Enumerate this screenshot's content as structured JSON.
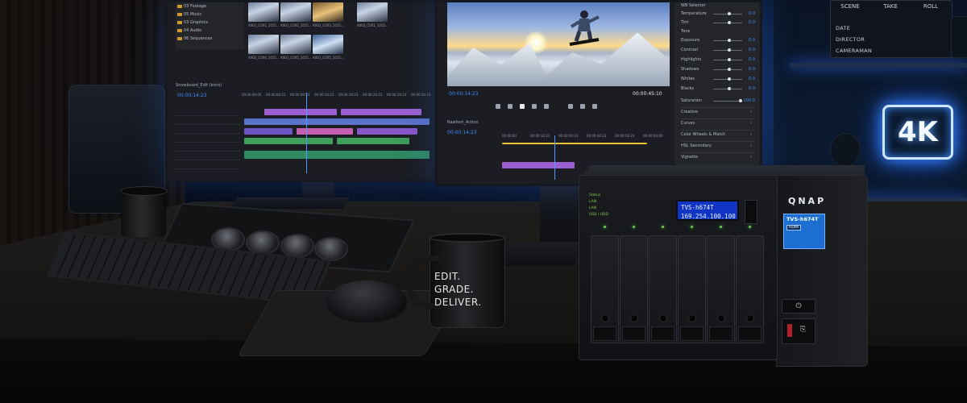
{
  "left_monitor": {
    "bins": [
      "03 Footage",
      "05 Music",
      "03 Graphics",
      "04 Audio",
      "06 Sequences"
    ],
    "clips": [
      "A001_C001_1015...",
      "A001_C002_1015...",
      "A002_C003_1015...",
      "A003_C001_1015...",
      "A002_C004_1015...",
      "A001_C005_1015...",
      "A001_C005_1015..."
    ],
    "sequence_tab": "Snowboard_Edit (Intro)",
    "timecode": "00:00:14:23",
    "ruler": [
      "00:00:00:00",
      "00:00:04:23",
      "00:00:09:23",
      "00:00:14:23",
      "00:00:19:23",
      "00:00:24:23",
      "00:00:29:23",
      "00:00:34:23"
    ]
  },
  "right_monitor": {
    "program_timecode": "00:00:14:23",
    "program_duration": "00:00:45:10",
    "sequence_tab": "Rawfoot_Action",
    "timecode": "00:00:14:23",
    "ruler": [
      "00:00:00",
      "00:00:14:23",
      "00:00:29:23",
      "00:00:44:23",
      "00:00:59:23",
      "00:00:00:00"
    ],
    "lumetri": {
      "header": "WB Selector",
      "rows": [
        {
          "label": "Temperature",
          "value": "0.0"
        },
        {
          "label": "Tint",
          "value": "0.0"
        },
        {
          "label": "Tone",
          "value": ""
        },
        {
          "label": "Exposure",
          "value": "0.0"
        },
        {
          "label": "Contrast",
          "value": "0.0"
        },
        {
          "label": "Highlights",
          "value": "0.0"
        },
        {
          "label": "Shadows",
          "value": "0.0"
        },
        {
          "label": "Whites",
          "value": "0.0"
        },
        {
          "label": "Blacks",
          "value": "0.0"
        },
        {
          "label": "Saturation",
          "value": "100.0"
        }
      ],
      "sections": [
        "Creative",
        "Curves",
        "Color Wheels & Match",
        "HSL Secondary",
        "Vignette"
      ]
    }
  },
  "clapperboard": {
    "tabs": [
      "SCENE",
      "TAKE",
      "ROLL"
    ],
    "lines": [
      "DATE",
      "DIRECTOR",
      "CAMERAMAN"
    ]
  },
  "neon_sign": "4K",
  "mug_text": [
    "EDIT.",
    "GRADE.",
    "DELIVER."
  ],
  "nas": {
    "brand": "QNAP",
    "lcd_line1": "TVS-h674T",
    "lcd_line2": "169.254.100.100",
    "status_leds": [
      "Status",
      "LAN",
      "LAN",
      "USB / HDD"
    ],
    "model_label": "TVS-h674T",
    "hdmi_badge": "HDMI"
  },
  "colors": {
    "accent": "#3d8bff",
    "lcd": "#1034c4",
    "nas_label": "#1c6fd0",
    "neon": "#3d8cff"
  }
}
